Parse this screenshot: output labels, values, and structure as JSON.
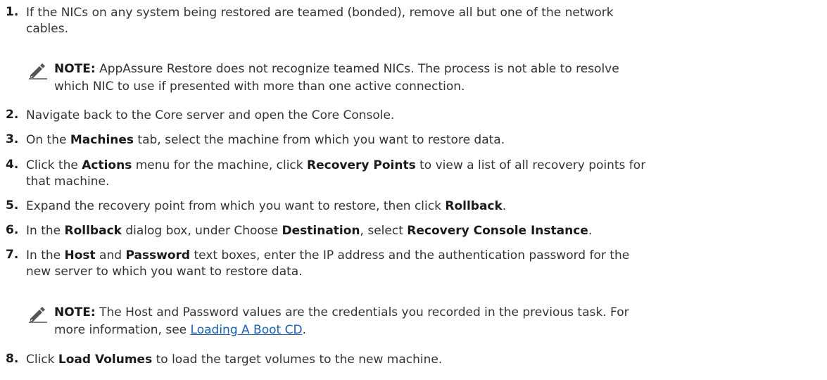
{
  "steps": [
    {
      "num": "1.",
      "line1": "If the NICs on any system being restored are teamed (bonded), remove all but one of the network",
      "line2": "cables."
    },
    {
      "num": "2.",
      "text": "Navigate back to the Core server and open the Core Console."
    },
    {
      "num": "3.",
      "pre": "On the ",
      "bold1": "Machines",
      "post": " tab, select the machine from which you want to restore data."
    },
    {
      "num": "4.",
      "pre": "Click the ",
      "bold1": "Actions",
      "mid": " menu for the machine, click ",
      "bold2": "Recovery Points",
      "post": " to view a list of all recovery points for",
      "line2": "that machine."
    },
    {
      "num": "5.",
      "pre": "Expand the recovery point from which you want to restore, then click ",
      "bold1": "Rollback",
      "post": "."
    },
    {
      "num": "6.",
      "pre": "In the ",
      "bold1": "Rollback",
      "mid": " dialog box, under Choose ",
      "bold2": "Destination",
      "mid2": ", select ",
      "bold3": "Recovery Console Instance",
      "post": "."
    },
    {
      "num": "7.",
      "pre": "In the ",
      "bold1": "Host",
      "mid": " and ",
      "bold2": "Password",
      "post": " text boxes, enter the IP address and the authentication password for the",
      "line2": "new server to which you want to restore data."
    },
    {
      "num": "8.",
      "pre": "Click ",
      "bold1": "Load Volumes",
      "post": " to load the target volumes to the new machine."
    }
  ],
  "notes": [
    {
      "icon": "pencil-note-icon",
      "label": "NOTE:",
      "line1": " AppAssure Restore does not recognize teamed NICs. The process is not able to resolve",
      "line2": "which NIC to use if presented with more than one active connection."
    },
    {
      "icon": "pencil-note-icon",
      "label": "NOTE:",
      "line1": " The Host and Password values are the credentials you recorded in the previous task. For",
      "line2_pre": "more information, see ",
      "link": "Loading A Boot CD",
      "line2_post": "."
    }
  ],
  "colors": {
    "text": "#333333",
    "bold": "#1a1a1a",
    "link": "#1a5fb4"
  }
}
